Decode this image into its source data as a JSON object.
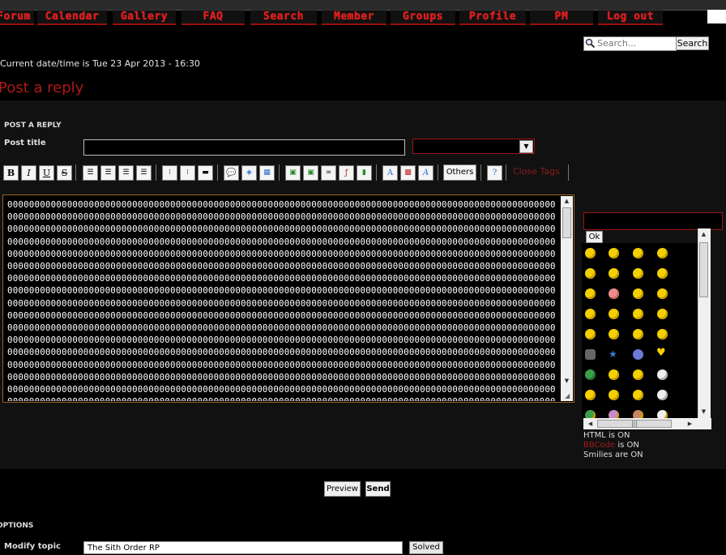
{
  "window": {
    "title": "Post a reply"
  },
  "nav": {
    "items": [
      "Forum",
      "Calendar",
      "Gallery",
      "FAQ",
      "Search",
      "Member",
      "Groups",
      "Profile",
      "PM",
      "Log out"
    ]
  },
  "search": {
    "placeholder": "Search...",
    "button_label": "Search"
  },
  "datetime": "Current date/time is Tue 23 Apr 2013 - 16:30",
  "page_title": "Post a reply",
  "form": {
    "heading": "POST A REPLY",
    "post_title_label": "Post title",
    "post_title_value": "",
    "toolbar": {
      "others_label": "Others",
      "close_tags_label": "Close Tags"
    },
    "message_text": "0000000000000000000000000000000000000000000000000000000000000000000000000000000000000000000000000000000000000000000000000000000000000000000000000000000000000000000000000000000000000000000000000000000000000000000000000000000000000000000000000000000000000000000000000000000000000000000000000000000000000000000000000000000000000000000000000000000000000000000000000000000000000000000000000000000000000000000000000000000000000000000000000000000000000000000000000000000000000000000000000000000000000000000000000000000000000000000000000000000000000000000000000000000000000000000000000000000000000000000000000000000000000000000000000000000000000000000000000000000000000000000000000000000000000000000000000000000000000000000000000000000000000000000000000000000000000000000000000000000000000000000000000000000000000000000000000000000000000000000000000000000000000000000000000000000000000000000000000000000000000000000000000000000000000000000000000000000000000000000000000000000000000000000000000000000000000000000000000000000000000000000000000000000000000000000000000000000000000000000000000000000000000000000000000000000000000000000000000000000000000000000000000000000000000000000000000000000000000000000000000000000000000000000000000000000000000000000000000000000000000000000000000000000000000000000000000000000000000000000000000000000000000000000000000000000000000000000000000000000000000000000000000000000000000000000000000000000000000000000000000000000000000000000000000000000000000000000000000000000000000000000000000000000000000000000000000000000000000000000000000000000000000000000000000000000000000000000000000000000000000000000000000000000000000000000000000000000000000000000000000000000000000000000000000000000000000000000000000000000000000000000000000000000000000000000000000000000000000000000000000000000000000000000000000000000000000000000000000000000000000000",
    "smilies_ok_label": "Ok",
    "status": {
      "html": "HTML is ON",
      "bbcode_link": "BBCode",
      "bbcode_suffix": " is ON",
      "smilies": "Smilies are ON"
    },
    "preview_label": "Preview",
    "send_label": "Send"
  },
  "options": {
    "heading": "OPTIONS",
    "modify_topic_label": "Modify topic",
    "modify_topic_value": "The Sith Order RP",
    "solved_label": "Solved"
  },
  "colors": {
    "background": "#000000",
    "panel": "#111111",
    "accent_red": "#b01818",
    "nav_text": "#e01b1b",
    "editor_border": "#9a6420"
  }
}
